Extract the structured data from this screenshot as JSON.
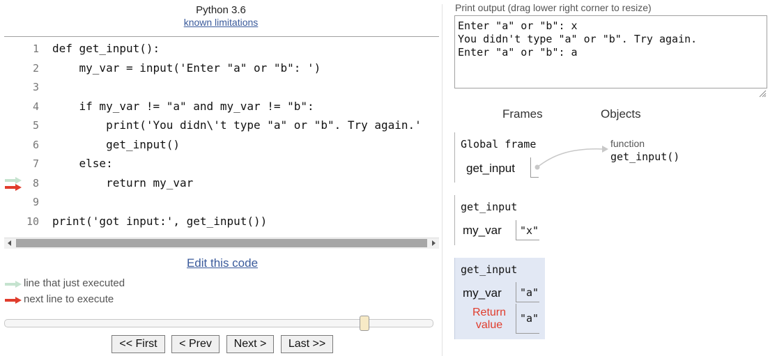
{
  "header": {
    "language": "Python 3.6",
    "limitations_link": "known limitations"
  },
  "code": {
    "lines": [
      {
        "no": "1",
        "text": "def get_input():"
      },
      {
        "no": "2",
        "text": "    my_var = input('Enter \"a\" or \"b\": ')"
      },
      {
        "no": "3",
        "text": ""
      },
      {
        "no": "4",
        "text": "    if my_var != \"a\" and my_var != \"b\":"
      },
      {
        "no": "5",
        "text": "        print('You didn\\'t type \"a\" or \"b\". Try again.'"
      },
      {
        "no": "6",
        "text": "        get_input()"
      },
      {
        "no": "7",
        "text": "    else:"
      },
      {
        "no": "8",
        "text": "        return my_var"
      },
      {
        "no": "9",
        "text": ""
      },
      {
        "no": "10",
        "text": "print('got input:', get_input())"
      }
    ],
    "just_executed_line": 8,
    "next_line": 8
  },
  "edit_link": "Edit this code",
  "legend": {
    "just_executed": "line that just executed",
    "next_line": "next line to execute"
  },
  "slider": {
    "position_fraction": 0.84
  },
  "nav": {
    "first": "<< First",
    "prev": "< Prev",
    "next": "Next >",
    "last": "Last >>"
  },
  "output": {
    "label": "Print output (drag lower right corner to resize)",
    "lines": [
      "Enter \"a\" or \"b\": x",
      "You didn't type \"a\" or \"b\". Try again.",
      "Enter \"a\" or \"b\": a"
    ]
  },
  "viz": {
    "frames_heading": "Frames",
    "objects_heading": "Objects",
    "global_frame": {
      "name": "Global frame",
      "var": "get_input"
    },
    "frame1": {
      "name": "get_input",
      "var": "my_var",
      "value": "\"x\""
    },
    "frame2": {
      "name": "get_input",
      "var": "my_var",
      "value": "\"a\"",
      "return_label": "Return value",
      "return_value": "\"a\""
    },
    "object": {
      "type": "function",
      "name": "get_input()"
    }
  },
  "colors": {
    "just_executed_arrow": "#c5e3cf",
    "next_line_arrow": "#e03c2c",
    "link": "#3a5a9b",
    "active_frame_bg": "#e2e8f4"
  }
}
